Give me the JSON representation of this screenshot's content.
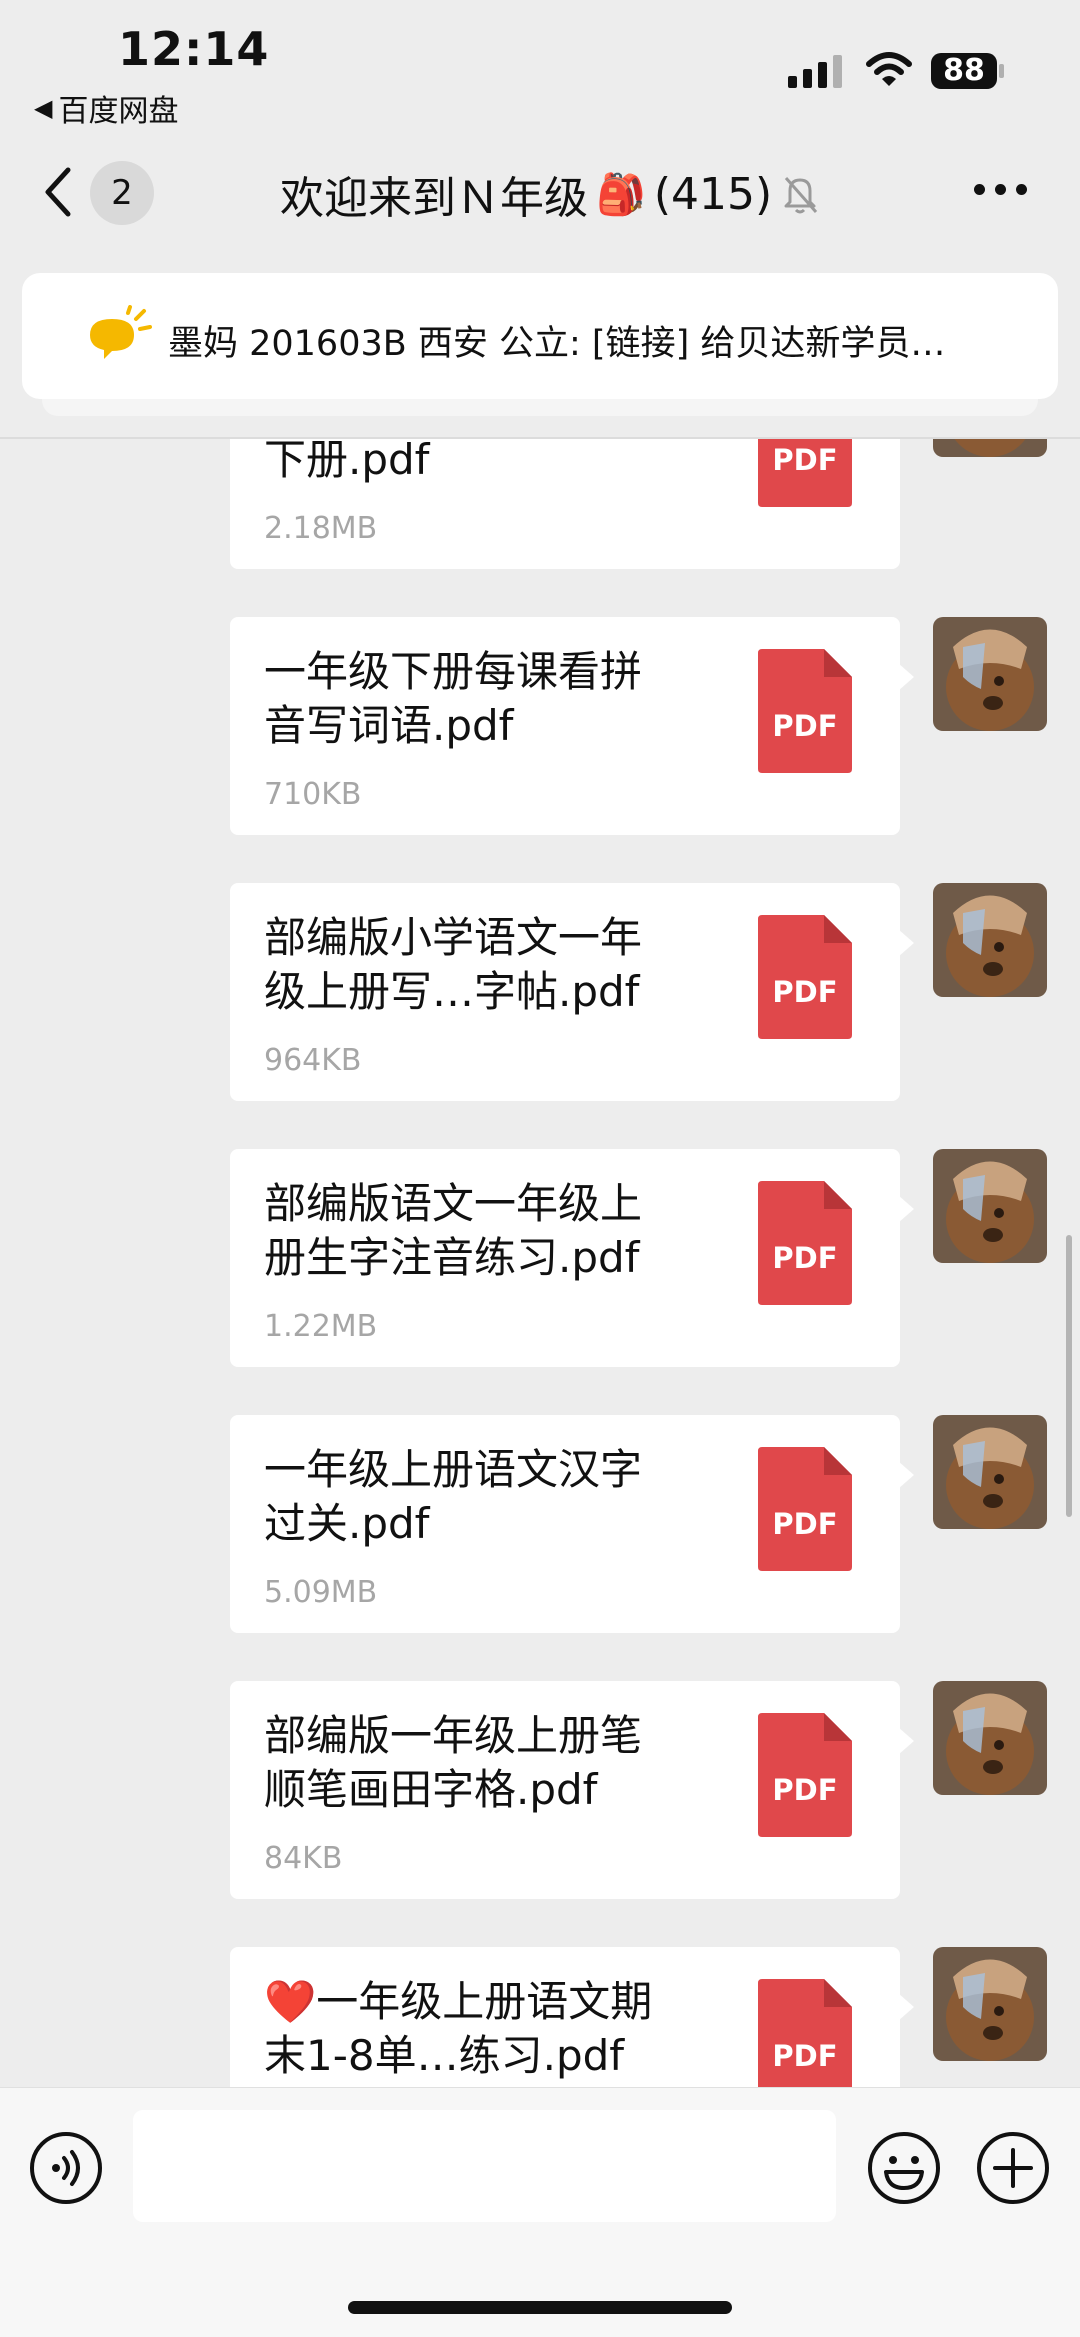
{
  "status_bar": {
    "time": "12:14",
    "back_app": "百度网盘",
    "battery": "88",
    "icons": [
      "signal-icon",
      "wifi-icon",
      "battery-icon"
    ]
  },
  "header": {
    "unread_count": "2",
    "title": "欢迎来到Ｎ年级",
    "title_emoji": "🎒",
    "member_count": "(415)",
    "icons": [
      "back-chevron-icon",
      "mute-bell-icon",
      "more-dots-icon"
    ]
  },
  "notice": {
    "text": "墨妈 201603B 西安 公立: [链接] 给贝达新学员…",
    "icon": "speaker-icon"
  },
  "messages": [
    {
      "name": "下册.pdf",
      "size": "2.18MB",
      "type": "PDF"
    },
    {
      "name": "一年级下册每课看拼\n音写词语.pdf",
      "size": "710KB",
      "type": "PDF"
    },
    {
      "name": "部编版小学语文一年\n级上册写…字帖.pdf",
      "size": "964KB",
      "type": "PDF"
    },
    {
      "name": "部编版语文一年级上\n册生字注音练习.pdf",
      "size": "1.22MB",
      "type": "PDF"
    },
    {
      "name": "一年级上册语文汉字\n过关.pdf",
      "size": "5.09MB",
      "type": "PDF"
    },
    {
      "name": "部编版一年级上册笔\n顺笔画田字格.pdf",
      "size": "84KB",
      "type": "PDF"
    },
    {
      "name": "❤️一年级上册语文期\n末1-8单…练习.pdf",
      "size": "",
      "type": "PDF"
    }
  ],
  "input_bar": {
    "placeholder": "",
    "icons": [
      "voice-icon",
      "emoji-icon",
      "plus-icon"
    ]
  },
  "colors": {
    "pdf_red": "#e0484b",
    "background": "#ededed",
    "bubble": "#ffffff",
    "notice_icon": "#f5b800"
  }
}
